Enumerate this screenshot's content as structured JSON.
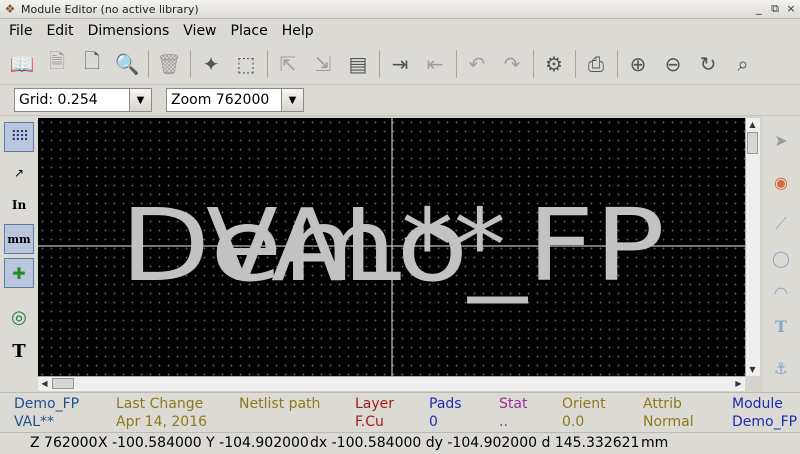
{
  "window": {
    "title": "Module Editor (no active library)",
    "controls": [
      "_",
      "⧉",
      "×"
    ]
  },
  "menu": [
    {
      "label": "File"
    },
    {
      "label": "Edit"
    },
    {
      "label": "Dimensions"
    },
    {
      "label": "View"
    },
    {
      "label": "Place"
    },
    {
      "label": "Help"
    }
  ],
  "options": {
    "grid_value": "Grid: 0.254",
    "zoom_value": "Zoom 762000"
  },
  "canvas": {
    "value_text": "VAL**",
    "reference_text": "Demo_FP",
    "colors": {
      "background": "#000000",
      "text": "#c2c2c2",
      "crosshair": "#e8e8e8",
      "grid": "#5a5a5a"
    }
  },
  "msg_panel": [
    {
      "title": "Demo_FP",
      "value": "VAL**",
      "title_color": "#1f4f8f",
      "value_color": "#1f4f8f"
    },
    {
      "title": "Last Change",
      "value": "Apr 14, 2016",
      "title_color": "#8b7a1b",
      "value_color": "#8b7a1b"
    },
    {
      "title": "Netlist path",
      "value": "",
      "title_color": "#8b7a1b",
      "value_color": "#8b7a1b"
    },
    {
      "title": "Layer",
      "value": "F.Cu",
      "title_color": "#a31a1a",
      "value_color": "#a31a1a"
    },
    {
      "title": "Pads",
      "value": "0",
      "title_color": "#1c2eb0",
      "value_color": "#1c2eb0"
    },
    {
      "title": "Stat",
      "value": "..",
      "title_color": "#9a2d9a",
      "value_color": "#9a2d9a"
    },
    {
      "title": "Orient",
      "value": "0.0",
      "title_color": "#8b7a1b",
      "value_color": "#8b7a1b"
    },
    {
      "title": "Attrib",
      "value": "Normal",
      "title_color": "#8b7a1b",
      "value_color": "#8b7a1b"
    },
    {
      "title": "Module",
      "value": "Demo_FP",
      "title_color": "#1c2eb0",
      "value_color": "#1c2eb0"
    }
  ],
  "status": {
    "zoom": "Z 762000",
    "abs_coords": "X -100.584000  Y -104.902000",
    "rel_coords": "dx -100.584000  dy -104.902000  d 145.332621",
    "units": "mm"
  }
}
